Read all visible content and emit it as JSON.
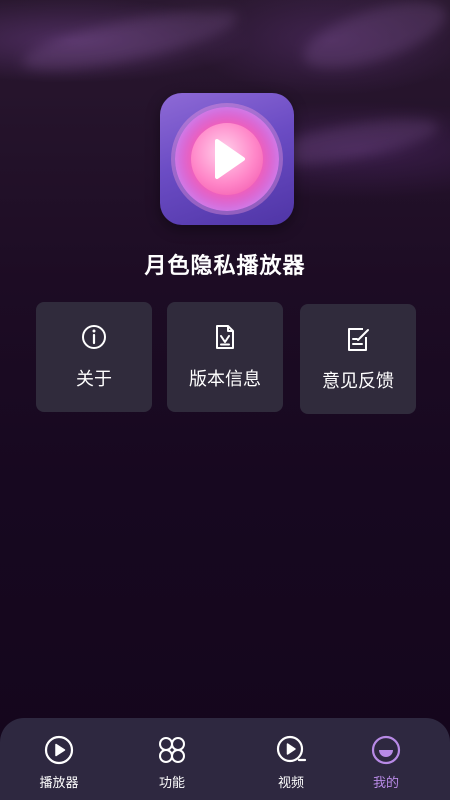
{
  "app": {
    "name": "月色隐私播放器",
    "icon": "play-logo-icon"
  },
  "menu": {
    "cards": [
      {
        "label": "关于",
        "icon": "info-icon"
      },
      {
        "label": "版本信息",
        "icon": "version-document-icon"
      },
      {
        "label": "意见反馈",
        "icon": "feedback-edit-icon"
      }
    ]
  },
  "tabbar": {
    "items": [
      {
        "label": "播放器",
        "icon": "play-circle-icon",
        "active": false
      },
      {
        "label": "功能",
        "icon": "features-grid-icon",
        "active": false
      },
      {
        "label": "视频",
        "icon": "video-icon",
        "active": false
      },
      {
        "label": "我的",
        "icon": "profile-icon",
        "active": true
      }
    ]
  },
  "colors": {
    "background": "#1a0a1e",
    "card": "#302b3c",
    "tabbar": "#2e2840",
    "accent": "#b88ae6"
  }
}
